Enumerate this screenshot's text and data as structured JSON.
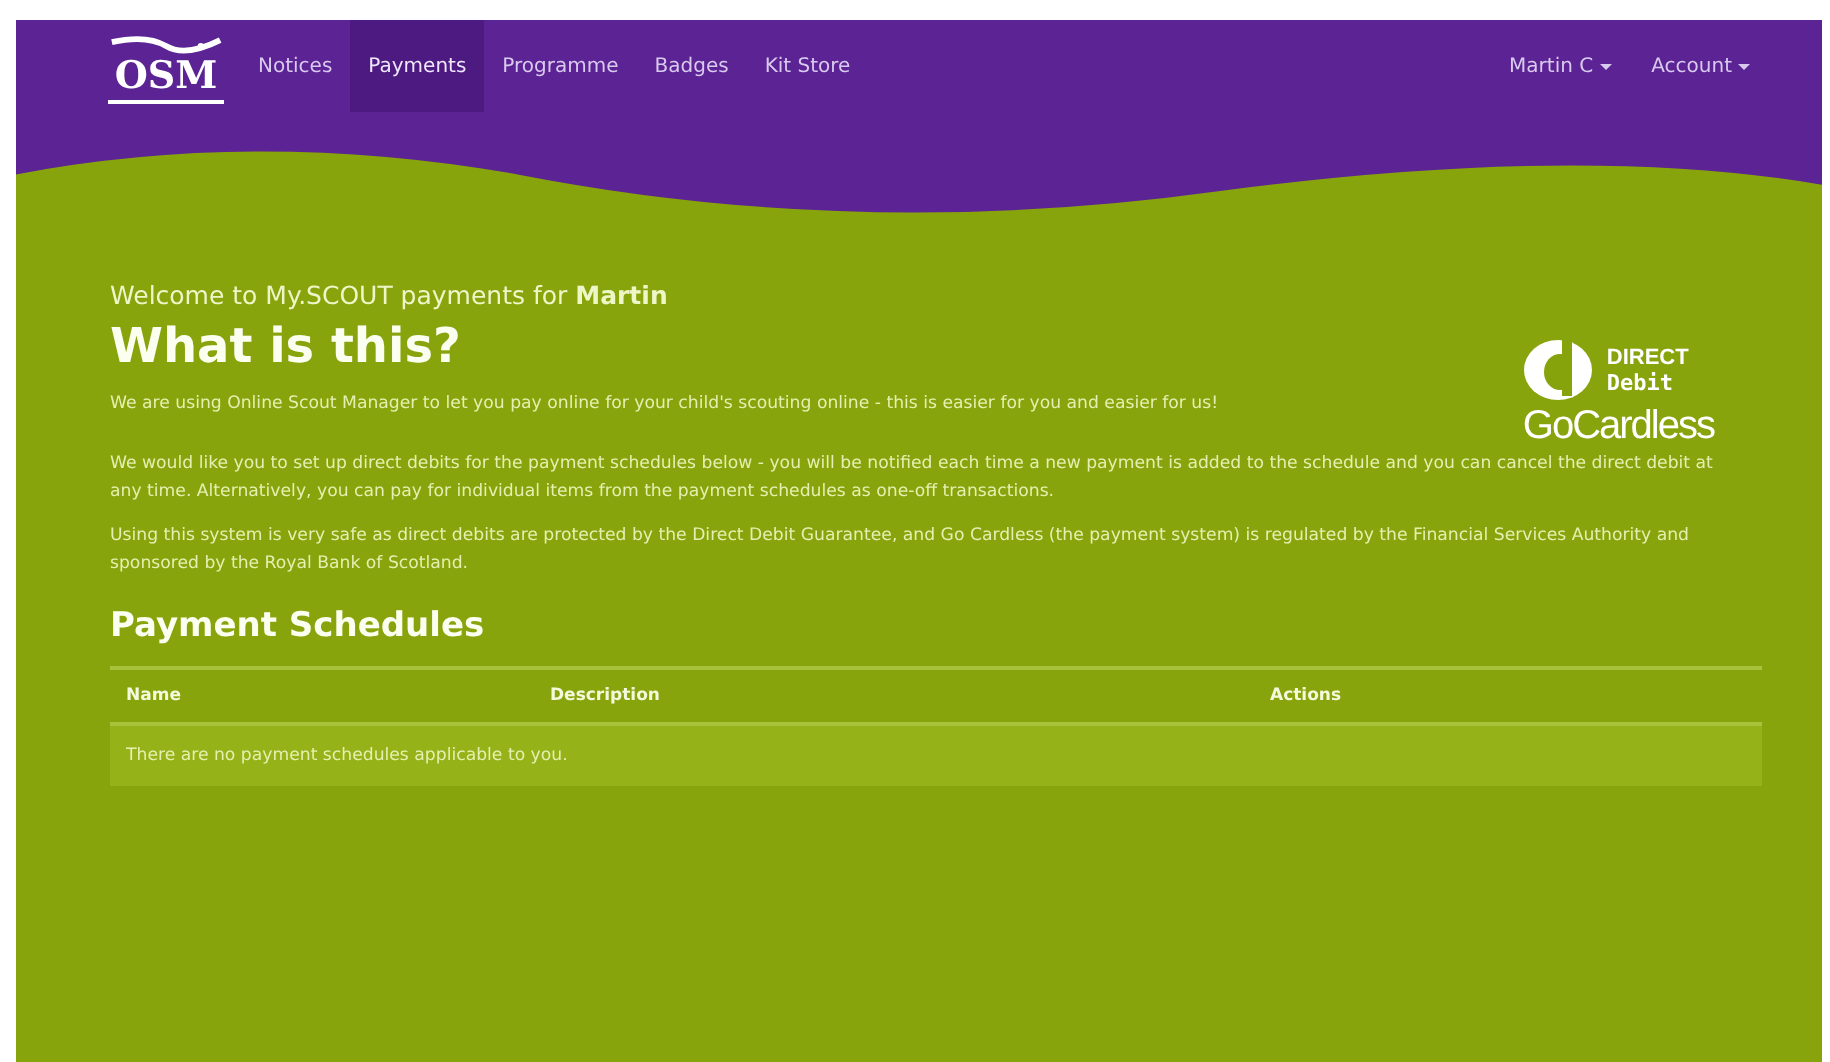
{
  "nav": {
    "logo": "OSM",
    "items": [
      {
        "label": "Notices",
        "selected": false
      },
      {
        "label": "Payments",
        "selected": true
      },
      {
        "label": "Programme",
        "selected": false
      },
      {
        "label": "Badges",
        "selected": false
      },
      {
        "label": "Kit Store",
        "selected": false
      }
    ],
    "right": [
      "Martin C",
      "Account"
    ]
  },
  "welcome": {
    "text": "Welcome to My.SCOUT payments for **Martin**"
  },
  "title": "What is this?",
  "paragraphs": [
    "We are using Online Scout Manager to let you pay online for your child's scouting online - this is easier for you and easier for us!",
    "We would like you to set up direct debits for the payment schedules below - you will be notified each time a new payment is added to the schedule and you can cancel the direct debit at any time. Alternatively, you can pay for individual items from the payment schedules as one-off transactions.",
    "Using this system is very safe as direct debits are protected by the Direct Debit Guarantee, and Go Cardless (the payment system) is regulated by the Financial Services Authority and sponsored by the Royal Bank of Scotland."
  ],
  "logo": {
    "direct": "DIRECT",
    "debit": "Debit",
    "brand": "GoCardless"
  },
  "schedules": {
    "title": "Payment Schedules",
    "columns": [
      "Name",
      "Description",
      "Actions"
    ],
    "empty": "There are no payment schedules applicable to you."
  }
}
